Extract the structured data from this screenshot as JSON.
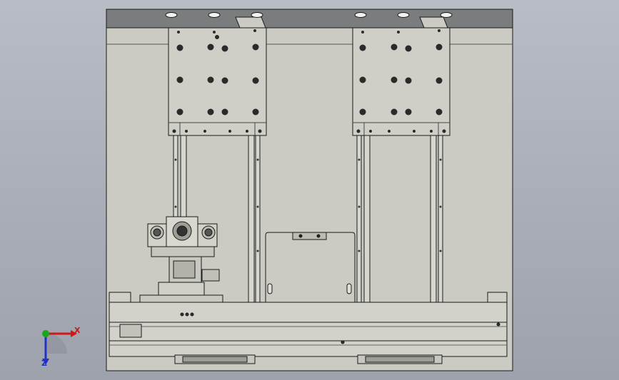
{
  "viewport": {
    "background_colors": [
      "#b8bcc4",
      "#9ea2ac"
    ],
    "model_fill": "#cbcbc3",
    "model_header_fill": "#7a7c7e",
    "edge_color": "#1a1a1a"
  },
  "triad": {
    "x_label": "X",
    "z_label": "Z",
    "x_color": "#d01818",
    "y_color": "#18a818",
    "z_color": "#2030c8"
  }
}
